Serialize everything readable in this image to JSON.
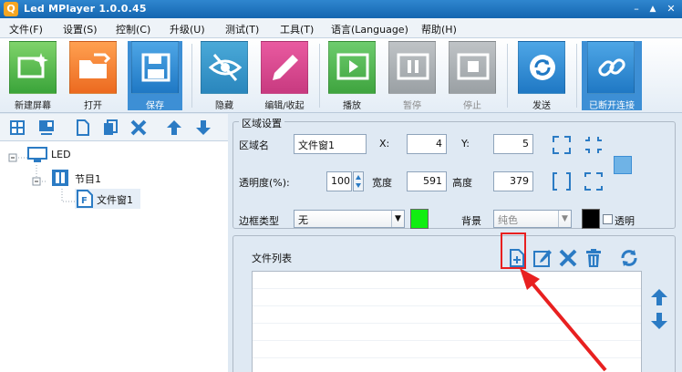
{
  "window": {
    "title": "Led MPlayer 1.0.0.45",
    "controls": [
      "–",
      "▲",
      "✕"
    ]
  },
  "menu": [
    "文件(F)",
    "设置(S)",
    "控制(C)",
    "升级(U)",
    "测试(T)",
    "工具(T)",
    "语言(Language)",
    "帮助(H)"
  ],
  "toolbar": {
    "new_screen": "新建屏幕",
    "open": "打开",
    "save": "保存",
    "hide": "隐藏",
    "edit_collapse": "编辑/收起",
    "play": "播放",
    "pause": "暂停",
    "stop": "停止",
    "send": "发送",
    "disconnect": "已断开连接"
  },
  "tree": {
    "root": "LED",
    "program": "节目1",
    "file_window": "文件窗1"
  },
  "region": {
    "legend": "区域设置",
    "name_label": "区域名",
    "name_value": "文件窗1",
    "x_label": "X:",
    "x_value": "4",
    "y_label": "Y:",
    "y_value": "5",
    "opacity_label": "透明度(%):",
    "opacity_value": "100",
    "width_label": "宽度",
    "width_value": "591",
    "height_label": "高度",
    "height_value": "379",
    "border_label": "边框类型",
    "border_value": "无",
    "bg_label": "背景",
    "bg_value": "纯色",
    "transparent_label": "透明"
  },
  "filelist": {
    "legend": "文件列表"
  },
  "colors": {
    "accent": "#3d8fd5",
    "border_color": "#11ee11",
    "bg_color": "#000000",
    "highlight": "#e82020"
  }
}
